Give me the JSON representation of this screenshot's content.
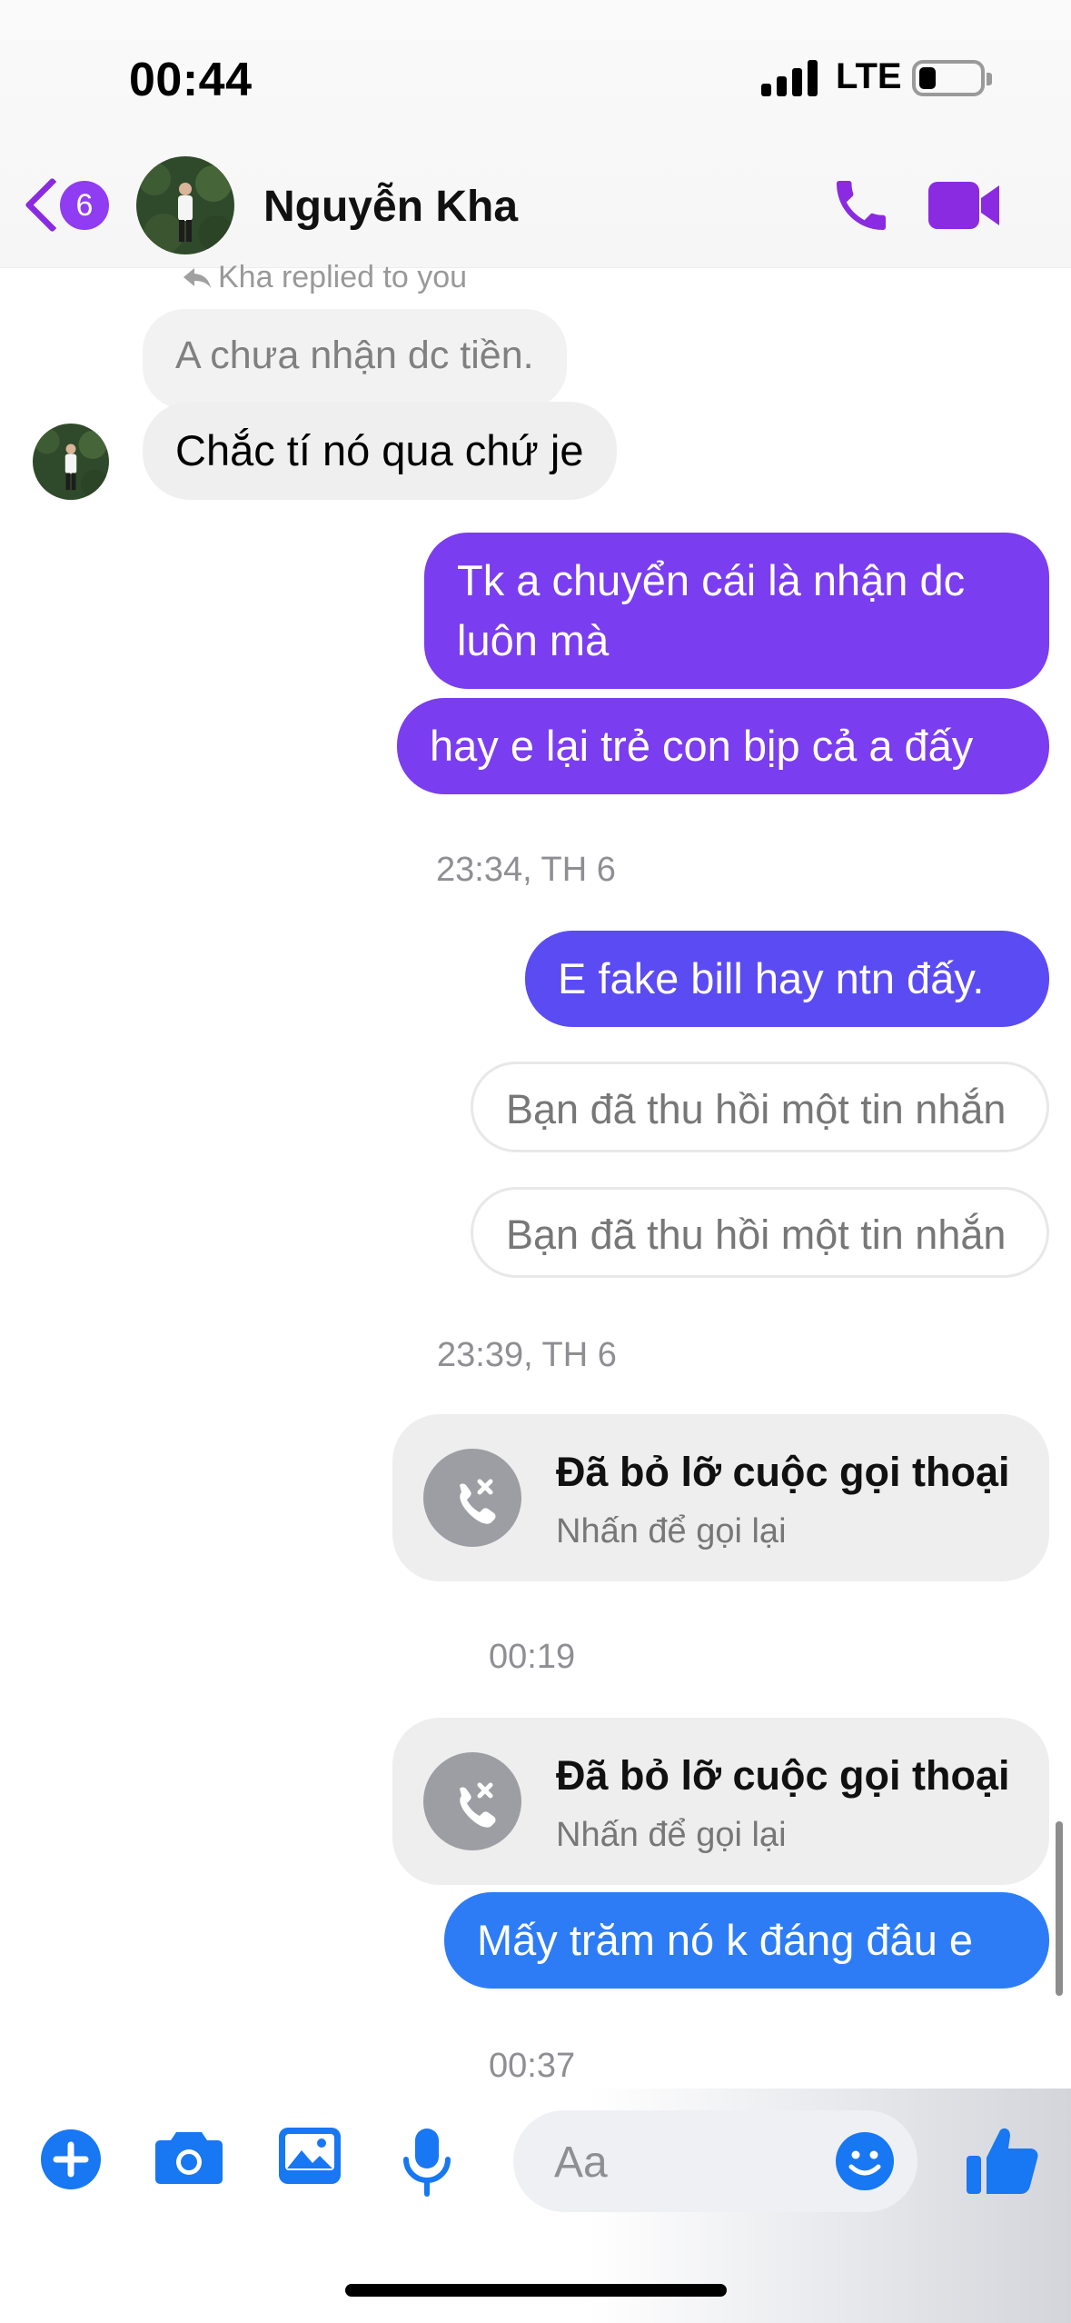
{
  "status_bar": {
    "time": "00:44",
    "network": "LTE"
  },
  "header": {
    "unread_count": "6",
    "contact_name": "Nguyễn Kha"
  },
  "messages": {
    "replied_note": "Kha replied to you",
    "quoted": "A chưa nhận dc tiền.",
    "incoming_1": "Chắc tí nó qua chứ je",
    "out_1": "Tk a chuyển cái là nhận dc luôn mà",
    "out_2": "hay e lại trẻ con bịp cả a đấy",
    "time_1": "23:34, TH 6",
    "out_3": "E fake bill hay ntn đấy.",
    "unsent_1": "Bạn đã thu hồi một tin nhắn",
    "unsent_2": "Bạn đã thu hồi một tin nhắn",
    "time_2": "23:39, TH 6",
    "missed_call_1": {
      "title": "Đã bỏ lỡ cuộc gọi thoại",
      "subtitle": "Nhấn để gọi lại"
    },
    "time_3": "00:19",
    "missed_call_2": {
      "title": "Đã bỏ lỡ cuộc gọi thoại",
      "subtitle": "Nhấn để gọi lại"
    },
    "out_4": "Mấy trăm nó k đáng đâu e",
    "time_4": "00:37"
  },
  "composer": {
    "placeholder": "Aa"
  },
  "colors": {
    "accent_purple": "#8a2be2",
    "bubble_purple": "#7a3df0",
    "bubble_indigo": "#5b4bf3",
    "bubble_blue": "#2d7cf6",
    "toolbar_blue": "#1877f2"
  },
  "icons": [
    "back-chevron-icon",
    "phone-icon",
    "video-camera-icon",
    "reply-arrow-icon",
    "missed-call-icon",
    "plus-icon",
    "camera-icon",
    "gallery-icon",
    "microphone-icon",
    "emoji-icon",
    "thumbs-up-icon"
  ]
}
